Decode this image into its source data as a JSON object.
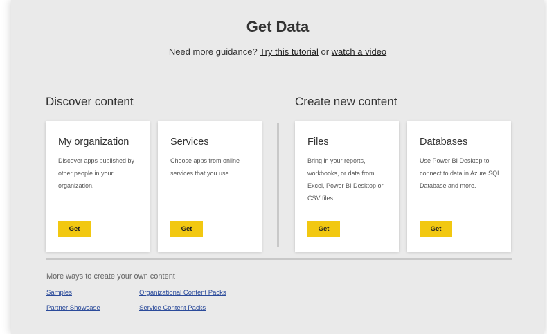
{
  "header": {
    "title": "Get Data",
    "guidance_prefix": "Need more guidance? ",
    "tutorial_link": "Try this tutorial",
    "guidance_or": " or ",
    "video_link": "watch a video"
  },
  "sections": {
    "discover_heading": "Discover content",
    "create_heading": "Create new content"
  },
  "cards": [
    {
      "title": "My organization",
      "description": "Discover apps published by other people in your organization.",
      "button": "Get"
    },
    {
      "title": "Services",
      "description": "Choose apps from online services that you use.",
      "button": "Get"
    },
    {
      "title": "Files",
      "description": "Bring in your reports, workbooks, or data from Excel, Power BI Desktop or CSV files.",
      "button": "Get"
    },
    {
      "title": "Databases",
      "description": "Use Power BI Desktop to connect to data in Azure SQL Database and more.",
      "button": "Get"
    }
  ],
  "more": {
    "label": "More ways to create your own content",
    "links": [
      "Samples",
      "Organizational Content Packs",
      "Partner Showcase",
      "Service Content Packs"
    ]
  },
  "colors": {
    "accent": "#f2c811",
    "panel_bg": "#eaeaea",
    "link": "#2a4a9a"
  }
}
